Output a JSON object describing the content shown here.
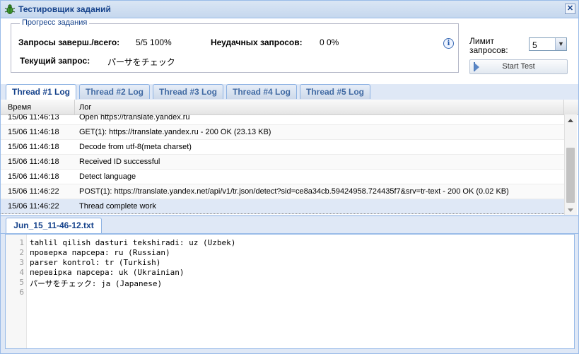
{
  "window": {
    "title": "Тестировщик заданий",
    "close_glyph": "✕"
  },
  "progress": {
    "legend": "Прогресс задания",
    "completed_label": "Запросы заверш./всего:",
    "completed_value": "5/5 100%",
    "failed_label": "Неудачных запросов:",
    "failed_value": "0 0%",
    "current_label": "Текущий запрос:",
    "current_value": "パーサをチェック",
    "info_glyph": "i"
  },
  "limit": {
    "label_line1": "Лимит",
    "label_line2": "запросов:",
    "value": "5",
    "arrow": "▼"
  },
  "start_button": {
    "label": "Start Test"
  },
  "thread_tabs": [
    {
      "label": "Thread #1 Log",
      "active": true
    },
    {
      "label": "Thread #2 Log",
      "active": false
    },
    {
      "label": "Thread #3 Log",
      "active": false
    },
    {
      "label": "Thread #4 Log",
      "active": false
    },
    {
      "label": "Thread #5 Log",
      "active": false
    }
  ],
  "log_grid": {
    "columns": [
      "Время",
      "Лог"
    ],
    "rows": [
      {
        "time": "15/06 11:46:13",
        "log": "Open https://translate.yandex.ru"
      },
      {
        "time": "15/06 11:46:18",
        "log": "GET(1): https://translate.yandex.ru - 200 OK (23.13 KB)"
      },
      {
        "time": "15/06 11:46:18",
        "log": "Decode from utf-8(meta charset)"
      },
      {
        "time": "15/06 11:46:18",
        "log": "Received ID successful"
      },
      {
        "time": "15/06 11:46:18",
        "log": "Detect language"
      },
      {
        "time": "15/06 11:46:22",
        "log": "POST(1): https://translate.yandex.net/api/v1/tr.json/detect?sid=ce8a34cb.59424958.724435f7&srv=tr-text - 200 OK (0.02 KB)"
      },
      {
        "time": "15/06 11:46:22",
        "log": "Thread complete work"
      }
    ]
  },
  "file_tab": {
    "label": "Jun_15_11-46-12.txt"
  },
  "file_lines": [
    "tahlil qilish dasturi tekshiradi: uz (Uzbek)",
    "проверка парсера: ru (Russian)",
    "parser kontrol: tr (Turkish)",
    "перевірка парсера: uk (Ukrainian)",
    "パーサをチェック: ja (Japanese)",
    ""
  ],
  "line_numbers": [
    "1",
    "2",
    "3",
    "4",
    "5",
    "6"
  ]
}
